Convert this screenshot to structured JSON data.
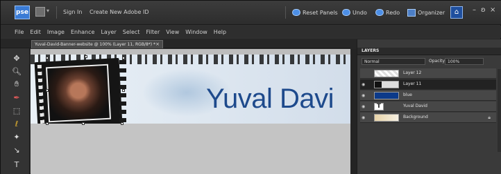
{
  "app": {
    "logo": "pse"
  },
  "topbar": {
    "sign_in": "Sign In",
    "create_id": "Create New Adobe ID",
    "reset_panels": "Reset Panels",
    "undo": "Undo",
    "redo": "Redo",
    "organizer": "Organizer",
    "win_min": "–",
    "win_restore": "ʚ",
    "win_close": "×"
  },
  "menu": [
    "File",
    "Edit",
    "Image",
    "Enhance",
    "Layer",
    "Select",
    "Filter",
    "View",
    "Window",
    "Help"
  ],
  "document": {
    "tab_title": "Yuval-David-Banner-website @ 100% (Layer 11, RGB/8*) *",
    "tab_close": "×",
    "banner_text": "Yuval Davi"
  },
  "layers_panel": {
    "title": "LAYERS",
    "blend_mode": "Normal",
    "opacity_label": "Opacity:",
    "opacity_value": "100%",
    "layers": [
      {
        "name": "Layer 12",
        "selected": false,
        "visible": false,
        "locked": false
      },
      {
        "name": "Layer 11",
        "selected": true,
        "visible": true,
        "locked": false
      },
      {
        "name": "blue",
        "selected": false,
        "visible": true,
        "locked": false
      },
      {
        "name": "Yuval David",
        "selected": false,
        "visible": true,
        "locked": false
      },
      {
        "name": "Background",
        "selected": false,
        "visible": true,
        "locked": true
      }
    ]
  },
  "colors": {
    "accent": "#3a7bd5",
    "banner_text": "#1e4a8c",
    "blue_layer": "#0c3a8a"
  }
}
